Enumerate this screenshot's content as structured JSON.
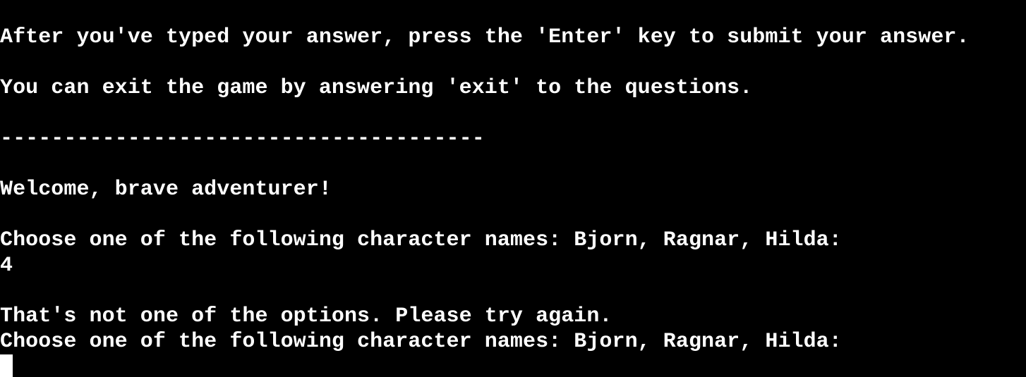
{
  "terminal": {
    "lines": [
      "After you've typed your answer, press the 'Enter' key to submit your answer.",
      "",
      "You can exit the game by answering 'exit' to the questions.",
      "",
      "--------------------------------------",
      "",
      "Welcome, brave adventurer!",
      "",
      "Choose one of the following character names: Bjorn, Ragnar, Hilda:",
      "4",
      "",
      "That's not one of the options. Please try again.",
      "Choose one of the following character names: Bjorn, Ragnar, Hilda:"
    ],
    "colors": {
      "background": "#000000",
      "foreground": "#ffffff"
    }
  }
}
